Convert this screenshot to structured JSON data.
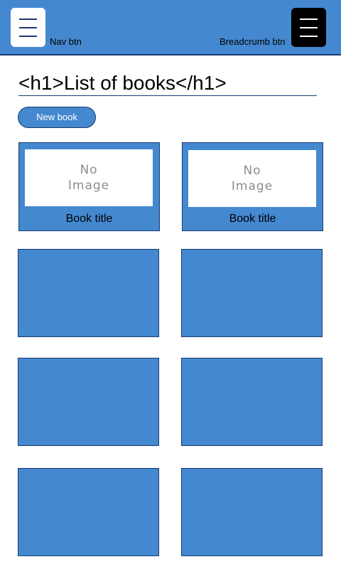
{
  "header": {
    "nav_label": "Nav btn",
    "breadcrumb_label": "Breadcrumb btn",
    "nav_icon": "hamburger-icon",
    "breadcrumb_icon": "hamburger-icon"
  },
  "page": {
    "title": "<h1>List of books</h1>",
    "new_book_label": "New book"
  },
  "books": [
    {
      "image_placeholder": "No\nImage",
      "title": "Book title"
    },
    {
      "image_placeholder": "No\nImage",
      "title": "Book title"
    }
  ],
  "colors": {
    "header_bg": "#4488d0",
    "border": "#1a3a70",
    "card_bg": "#4488d0"
  }
}
